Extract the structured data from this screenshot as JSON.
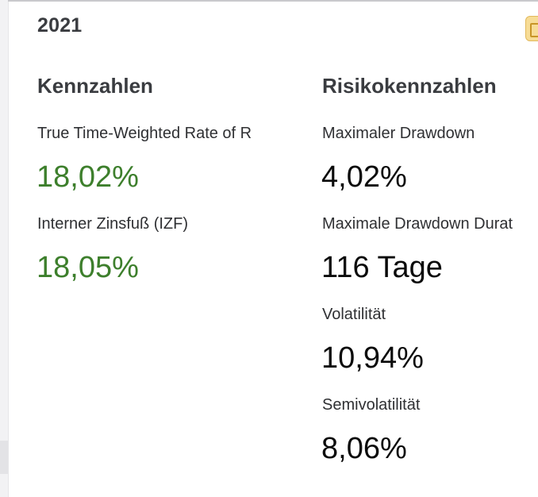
{
  "header": {
    "year": "2021"
  },
  "colors": {
    "positive": "#3d7f2c",
    "neutral": "#0b0b0b",
    "heading": "#3a3c40",
    "button_accent": "#f7dc96"
  },
  "kennzahlen": {
    "heading": "Kennzahlen",
    "metrics": [
      {
        "label": "True Time-Weighted Rate of R",
        "value": "18,02%"
      },
      {
        "label": "Interner Zinsfuß (IZF)",
        "value": "18,05%"
      }
    ]
  },
  "risikokennzahlen": {
    "heading": "Risikokennzahlen",
    "metrics": [
      {
        "label": "Maximaler Drawdown",
        "value": "4,02%"
      },
      {
        "label": "Maximale Drawdown Durat",
        "value": "116 Tage"
      },
      {
        "label": "Volatilität",
        "value": "10,94%"
      },
      {
        "label": "Semivolatilität",
        "value": "8,06%"
      }
    ]
  },
  "icons": {
    "corner_button": "calendar-icon"
  }
}
